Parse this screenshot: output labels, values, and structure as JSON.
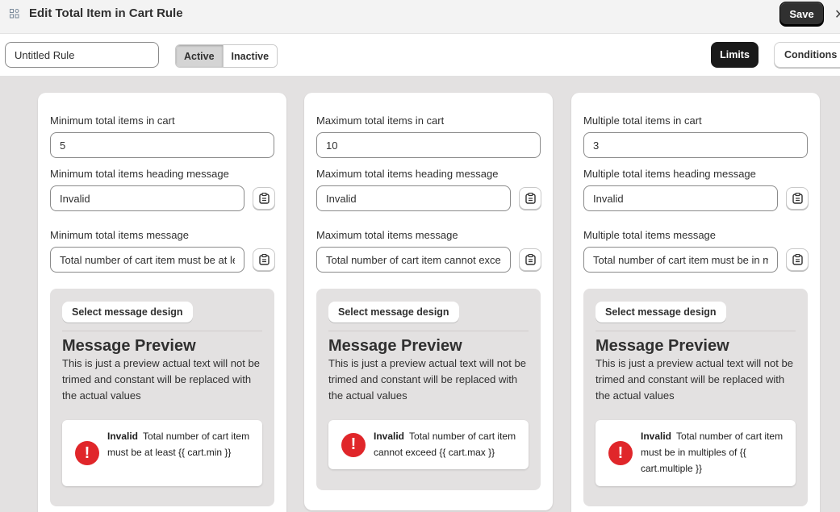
{
  "header": {
    "title": "Edit Total Item in Cart Rule",
    "save_label": "Save",
    "close_glyph": "✕"
  },
  "toolbar": {
    "rule_name": "Untitled Rule",
    "status": {
      "active_label": "Active",
      "inactive_label": "Inactive",
      "selected": "Active"
    },
    "tabs": {
      "limits_label": "Limits",
      "conditions_label": "Conditions",
      "selected": "Limits"
    }
  },
  "cards": [
    {
      "value_label": "Minimum total items in cart",
      "value": "5",
      "heading_label": "Minimum total items heading message",
      "heading_value": "Invalid",
      "message_label": "Minimum total items message",
      "message_value": "Total number of cart item must be at least {{ cart.min }}",
      "design_button": "Select message design",
      "preview_title": "Message Preview",
      "preview_desc": "This is just a preview actual text will not be trimed and constant will be replaced with the actual values",
      "msg_heading": "Invalid",
      "msg_body": "Total number of cart item must be at least {{ cart.min }}"
    },
    {
      "value_label": "Maximum total items in cart",
      "value": "10",
      "heading_label": "Maximum total items heading message",
      "heading_value": "Invalid",
      "message_label": "Maximum total items message",
      "message_value": "Total number of cart item cannot exceed {{ cart.max }}",
      "design_button": "Select message design",
      "preview_title": "Message Preview",
      "preview_desc": "This is just a preview actual text will not be trimed and constant will be replaced with the actual values",
      "msg_heading": "Invalid",
      "msg_body": "Total number of cart item cannot exceed {{ cart.max }}"
    },
    {
      "value_label": "Multiple total items in cart",
      "value": "3",
      "heading_label": "Multiple total items heading message",
      "heading_value": "Invalid",
      "message_label": "Multiple total items message",
      "message_value": "Total number of cart item must be in multiples of {{ cart.multiple }}",
      "design_button": "Select message design",
      "preview_title": "Message Preview",
      "preview_desc": "This is just a preview actual text will not be trimed and constant will be replaced with the actual values",
      "msg_heading": "Invalid",
      "msg_body": "Total number of cart item must be in multiples of {{ cart.multiple }}"
    }
  ],
  "icons": {
    "app": "app-grid-icon",
    "copy": "clipboard-icon",
    "error": "error-circle-icon",
    "close": "close-icon"
  },
  "colors": {
    "primary": "#303030",
    "error": "#e0262a",
    "canvas": "#e3e1e1"
  }
}
